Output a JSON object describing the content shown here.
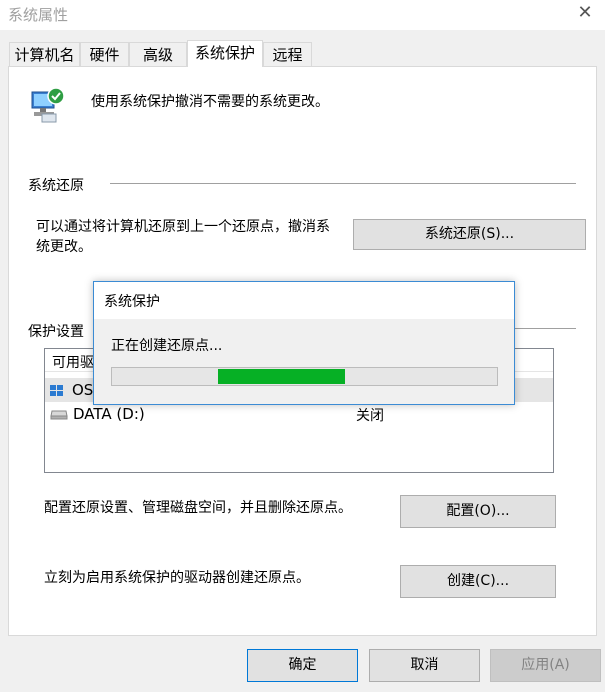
{
  "window": {
    "title": "系统属性",
    "close_glyph": "✕"
  },
  "tabs": [
    {
      "label": "计算机名"
    },
    {
      "label": "硬件"
    },
    {
      "label": "高级"
    },
    {
      "label": "系统保护",
      "active": true
    },
    {
      "label": "远程"
    }
  ],
  "intro": {
    "text": "使用系统保护撤消不需要的系统更改。",
    "icon": "system-protection-icon"
  },
  "restore": {
    "heading": "系统还原",
    "description_line1": "可以通过将计算机还原到上一个还原点，撤消系",
    "description_line2": "统更改。",
    "button": "系统还原(S)..."
  },
  "protection": {
    "heading": "保护设置",
    "list_header_col1": "可用驱",
    "drives": [
      {
        "name": "OS",
        "status": "",
        "icon": "system-drive-icon"
      },
      {
        "name": "DATA (D:)",
        "status": "关闭",
        "icon": "drive-icon"
      }
    ]
  },
  "configure": {
    "text": "配置还原设置、管理磁盘空间，并且删除还原点。",
    "button": "配置(O)..."
  },
  "create": {
    "text": "立刻为启用系统保护的驱动器创建还原点。",
    "button": "创建(C)..."
  },
  "footer": {
    "ok": "确定",
    "cancel": "取消",
    "apply": "应用(A)"
  },
  "progress_dialog": {
    "title": "系统保护",
    "message": "正在创建还原点...",
    "progress_fraction": 0.33,
    "progress_color": "#06b025"
  }
}
